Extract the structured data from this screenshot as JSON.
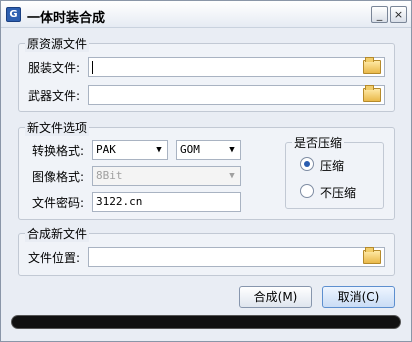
{
  "window": {
    "title": "一体时装合成",
    "icon": "G"
  },
  "titlebar": {
    "minimize": "_",
    "close": "×"
  },
  "source_group": {
    "title": "原资源文件",
    "clothing_label": "服装文件:",
    "clothing_value": "",
    "weapon_label": "武器文件:",
    "weapon_value": ""
  },
  "new_file_options": {
    "title": "新文件选项",
    "convert_label": "转换格式:",
    "convert_from": "PAK",
    "convert_to": "GOM",
    "image_label": "图像格式:",
    "image_value": "8Bit",
    "password_label": "文件密码:",
    "password_value": "3122.cn"
  },
  "compress_group": {
    "title": "是否压缩",
    "option_yes": "压缩",
    "option_no": "不压缩",
    "selected": "压缩"
  },
  "merge_group": {
    "title": "合成新文件",
    "location_label": "文件位置:",
    "location_value": ""
  },
  "buttons": {
    "merge": "合成(M)",
    "cancel": "取消(C)"
  },
  "progress": {
    "value": 0
  }
}
